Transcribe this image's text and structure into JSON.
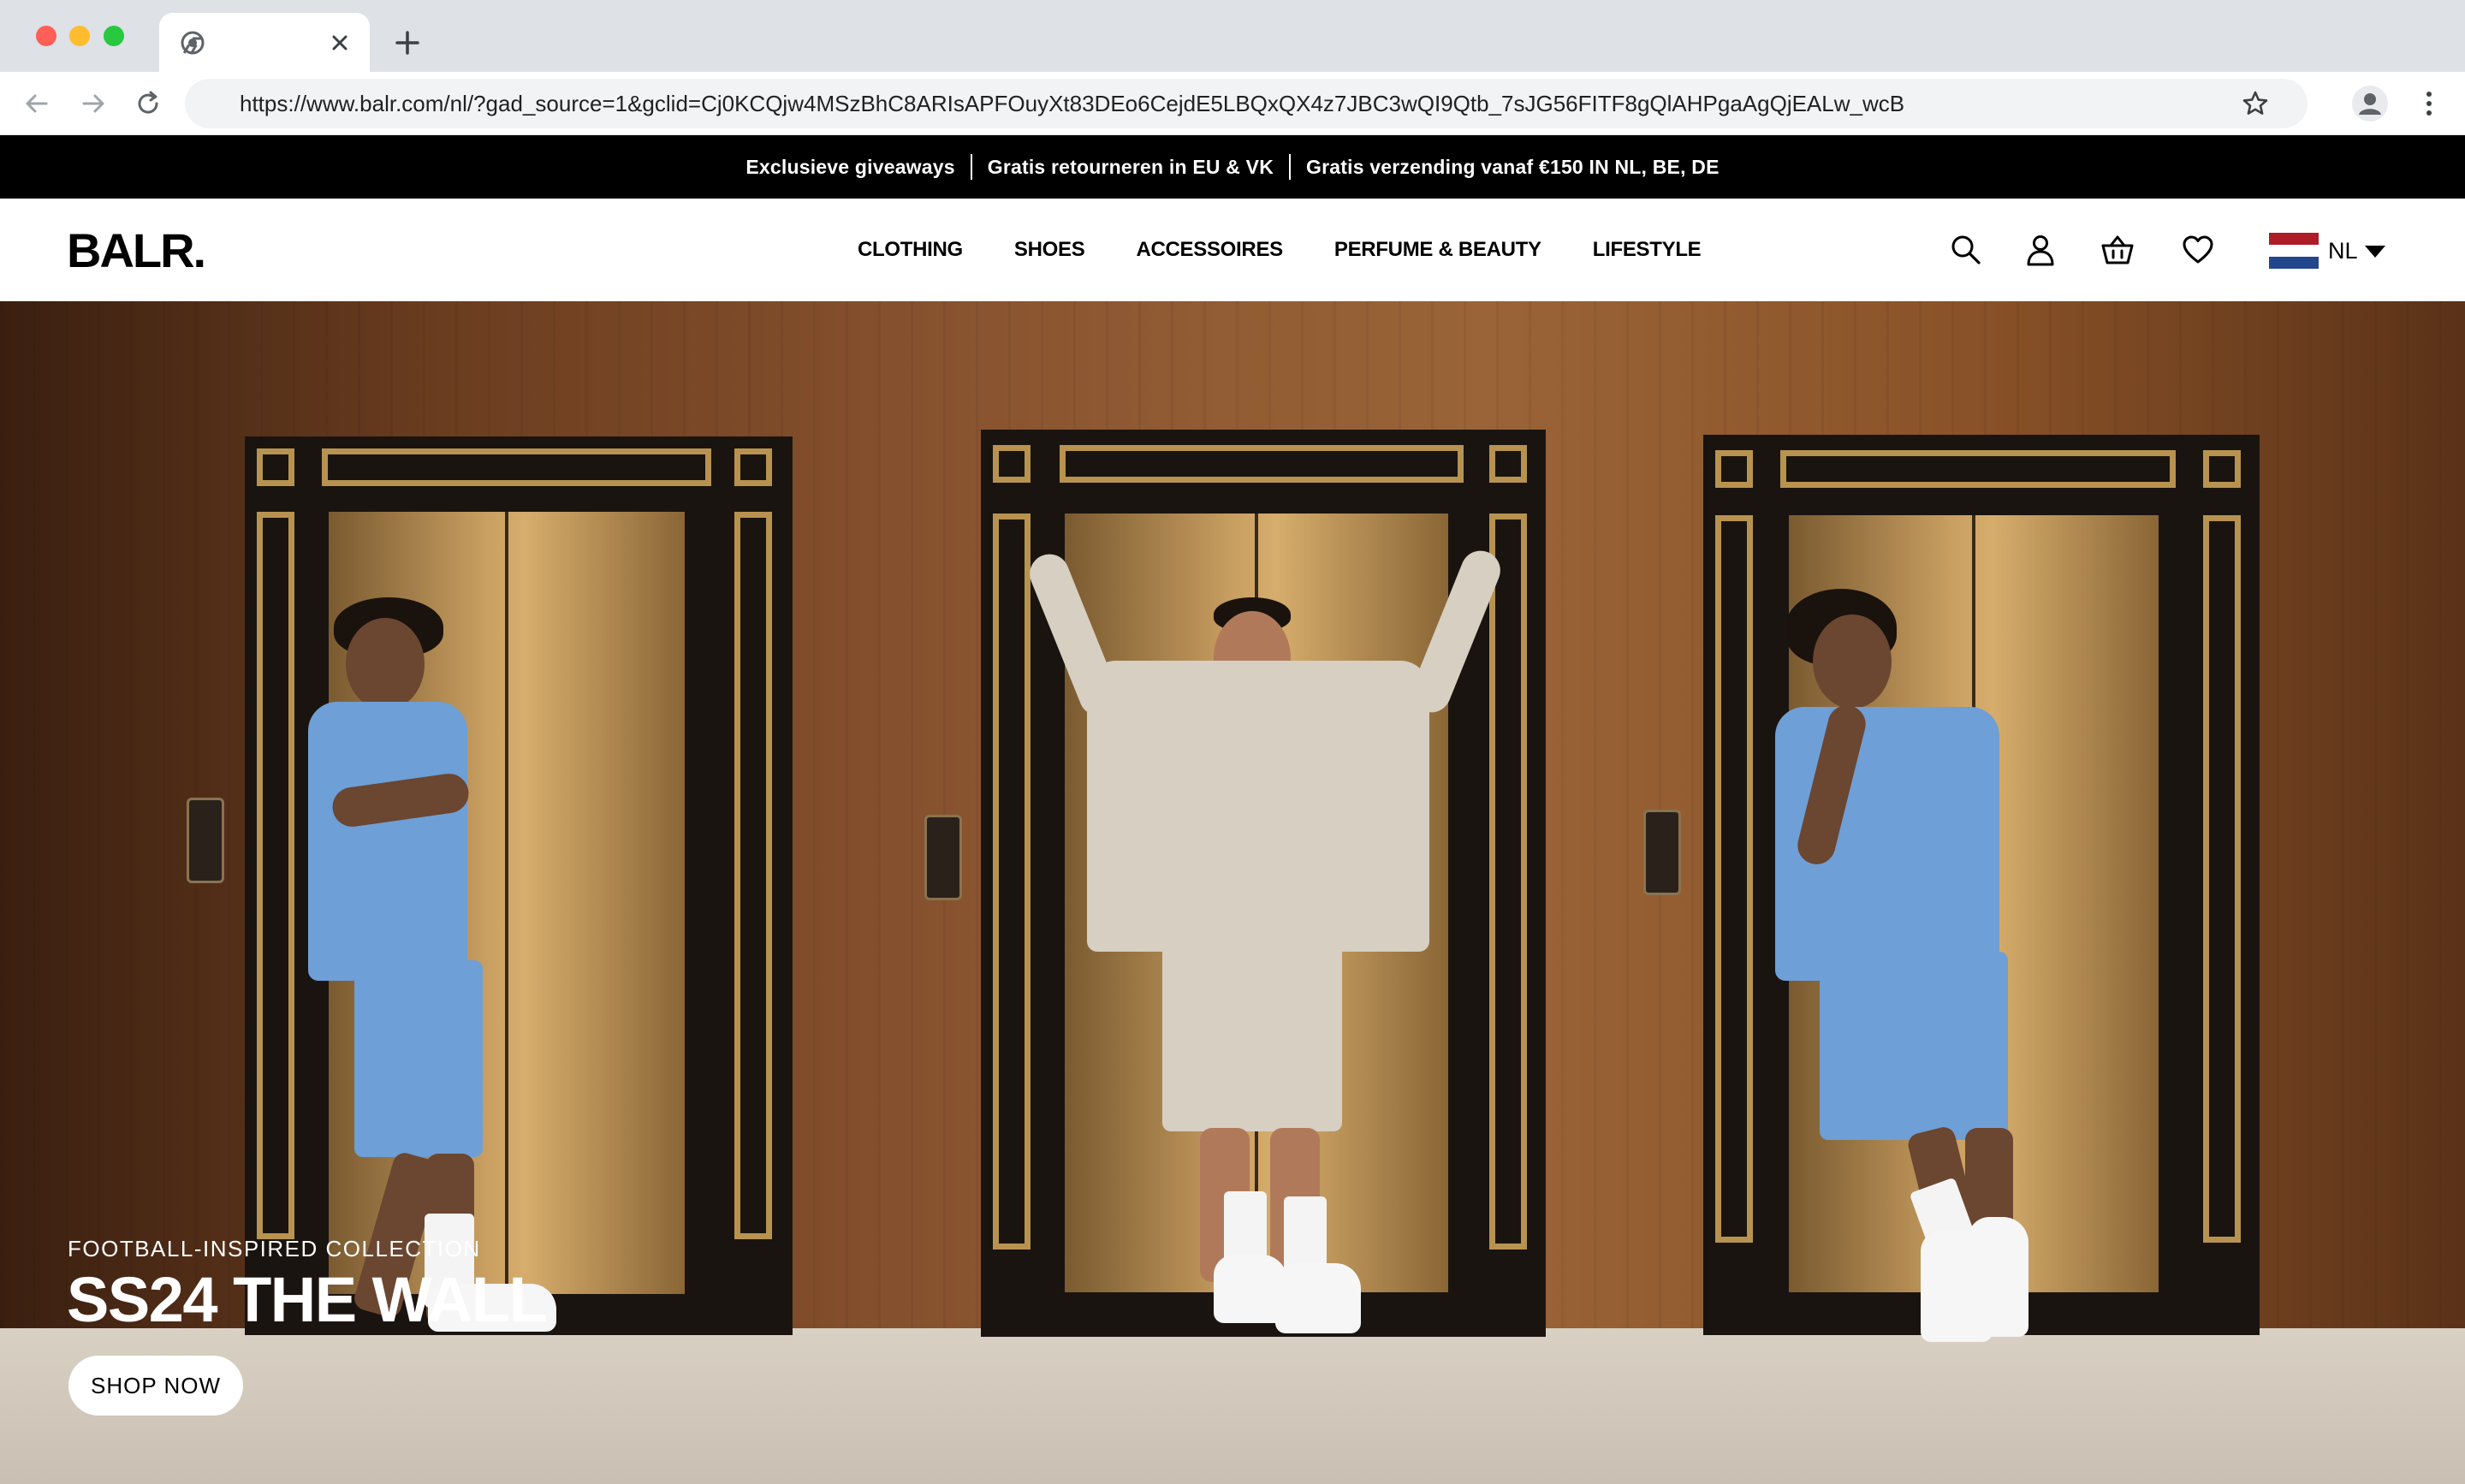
{
  "browser": {
    "tab_title": "",
    "url": "https://www.balr.com/nl/?gad_source=1&gclid=Cj0KCQjw4MSzBhC8ARIsAPFOuyXt83DEo6CejdE5LBQxQX4z7JBC3wQI9Qtb_7sJG56FITF8gQlAHPgaAgQjEALw_wcB"
  },
  "announcement": {
    "items": [
      "Exclusieve giveaways",
      "Gratis retourneren in EU & VK",
      "Gratis verzending vanaf €150 IN NL, BE, DE"
    ]
  },
  "header": {
    "logo": "BALR.",
    "nav": [
      "CLOTHING",
      "SHOES",
      "ACCESSOIRES",
      "PERFUME & BEAUTY",
      "LIFESTYLE"
    ],
    "language": "NL",
    "icons": [
      "search-icon",
      "account-icon",
      "basket-icon",
      "wishlist-heart-icon",
      "netherlands-flag-icon",
      "caret-down-icon"
    ]
  },
  "hero": {
    "subtitle": "FOOTBALL-INSPIRED COLLECTION",
    "title": "SS24 THE WALL",
    "cta": "SHOP NOW"
  },
  "colors": {
    "announcement_bg": "#000000",
    "flag_red": "#ae1c28",
    "flag_white": "#ffffff",
    "flag_blue": "#21468b",
    "blue_outfit": "#6e9fd6",
    "beige_outfit": "#d6cfc2"
  }
}
